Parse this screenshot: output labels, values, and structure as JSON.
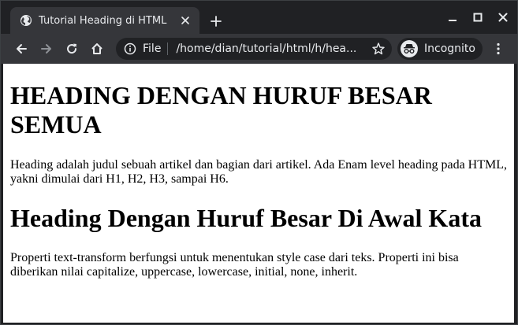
{
  "tab": {
    "title": "Tutorial Heading di HTML"
  },
  "omnibox": {
    "scheme": "File",
    "url": "/home/dian/tutorial/html/h/hea..."
  },
  "profile": {
    "label": "Incognito"
  },
  "page": {
    "heading1": "HEADING DENGAN HURUF BESAR SEMUA",
    "paragraph1": "Heading adalah judul sebuah artikel dan bagian dari artikel. Ada Enam level heading pada HTML, yakni dimulai dari H1, H2, H3, sampai H6.",
    "heading2": "Heading Dengan Huruf Besar Di Awal Kata",
    "paragraph2": "Properti text-transform berfungsi untuk menentukan style case dari teks. Properti ini bisa diberikan nilai capitalize, uppercase, lowercase, initial, none, inherit."
  },
  "colors": {
    "frame": "#202124",
    "toolbar": "#35363a",
    "icon": "#e8eaed",
    "page_bg": "#ffffff"
  }
}
